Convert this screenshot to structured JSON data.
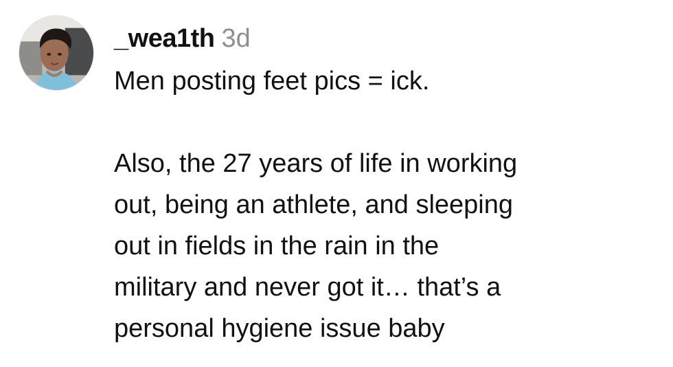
{
  "comment": {
    "avatar_icon": "user-profile-photo",
    "username": "_wea1th",
    "timestamp": "3d",
    "text_line_1": "Men posting feet pics = ick.",
    "paragraph_lines": [
      "Also, the 27 years of life in working",
      "out, being an athlete, and sleeping",
      "out in fields in the rain in the",
      "military and never got it… that’s a",
      "personal hygiene issue baby"
    ]
  }
}
